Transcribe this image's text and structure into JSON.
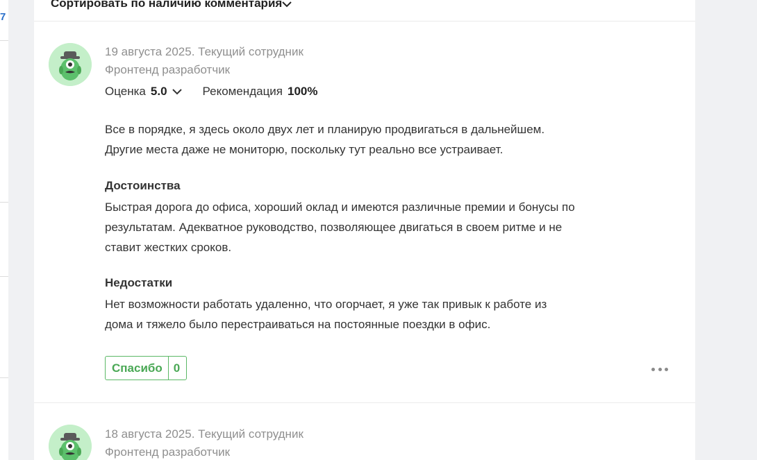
{
  "sidebar": {
    "number": "7"
  },
  "sort": {
    "label": "Сортировать по наличию комментария",
    "chevron_icon": "chevron-down-icon"
  },
  "colors": {
    "accent_green": "#4aa855",
    "link_blue": "#2a6fc9",
    "meta_gray": "#8f8f8f",
    "avatar_bg": "#c4efc9"
  },
  "reviews": [
    {
      "date": "19 августа 2025. Текущий сотрудник",
      "position": "Фронтенд разработчик",
      "rating_label": "Оценка",
      "rating_value": "5.0",
      "recommend_label": "Рекомендация",
      "recommend_value": "100%",
      "text_lines": [
        "Все в порядке, я здесь около двух лет и планирую продвигаться в дальнейшем.",
        "Другие места даже не мониторю, поскольку тут реально все устраивает."
      ],
      "pros_title": "Достоинства",
      "pros_lines": [
        "Быстрая дорога до офиса, хороший оклад и имеются различные премии и бонусы по",
        "результатам. Адекватное руководство, позволяющее двигаться в своем ритме и не",
        "ставит жестких сроков."
      ],
      "cons_title": "Недостатки",
      "cons_lines": [
        "Нет возможности работать удаленно, что огорчает, я уже так привык к работе из",
        "дома и тяжело было перестраиваться на постоянные поездки в офис."
      ],
      "thanks_label": "Спасибо",
      "thanks_count": "0",
      "more_icon": "more-horizontal-icon"
    },
    {
      "date": "18 августа 2025. Текущий сотрудник",
      "position": "Фронтенд разработчик"
    }
  ]
}
